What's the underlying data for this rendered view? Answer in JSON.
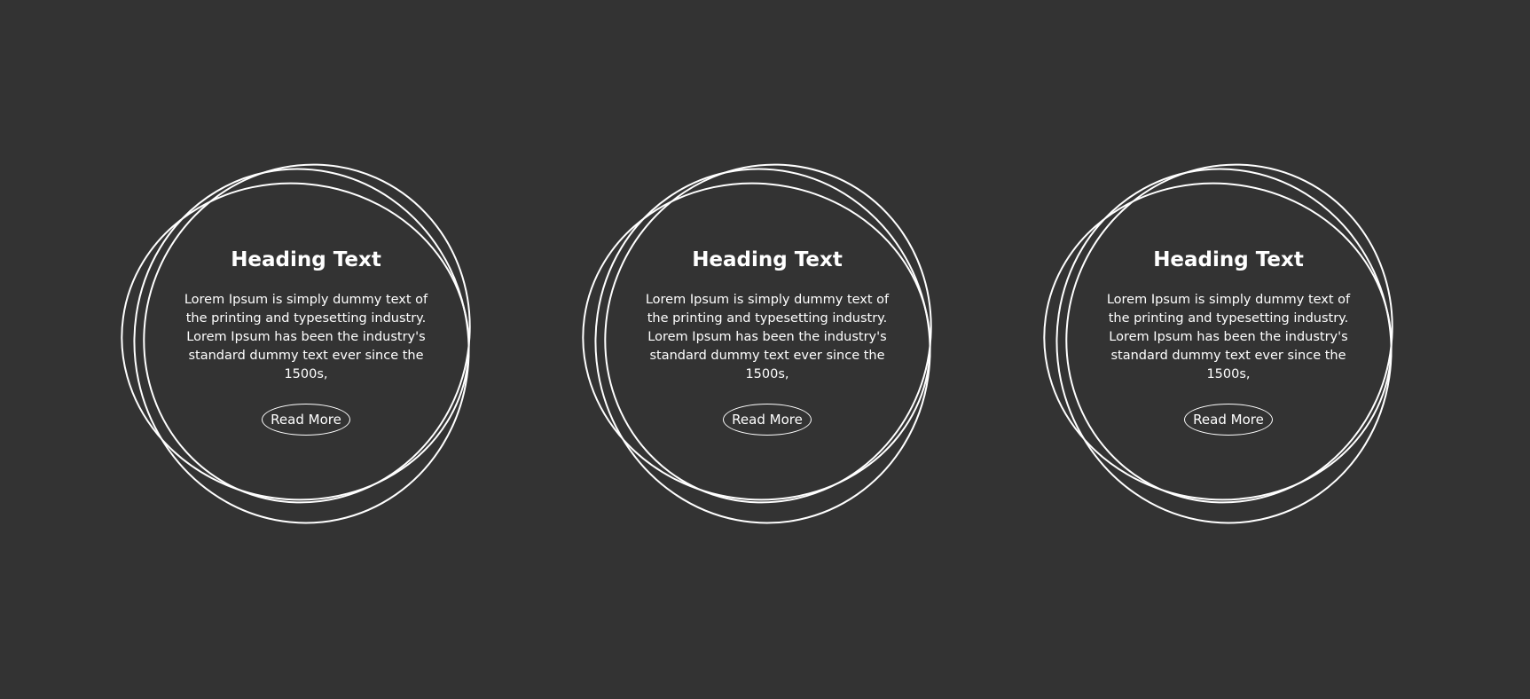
{
  "colors": {
    "background": "#333333",
    "foreground": "#ffffff"
  },
  "cards": [
    {
      "heading": "Heading Text",
      "body": "Lorem Ipsum is simply dummy text of the printing and typesetting industry. Lorem Ipsum has been the industry's standard dummy text ever since the 1500s,",
      "button_label": "Read More"
    },
    {
      "heading": "Heading Text",
      "body": "Lorem Ipsum is simply dummy text of the printing and typesetting industry. Lorem Ipsum has been the industry's standard dummy text ever since the 1500s,",
      "button_label": "Read More"
    },
    {
      "heading": "Heading Text",
      "body": "Lorem Ipsum is simply dummy text of the printing and typesetting industry. Lorem Ipsum has been the industry's standard dummy text ever since the 1500s,",
      "button_label": "Read More"
    }
  ]
}
